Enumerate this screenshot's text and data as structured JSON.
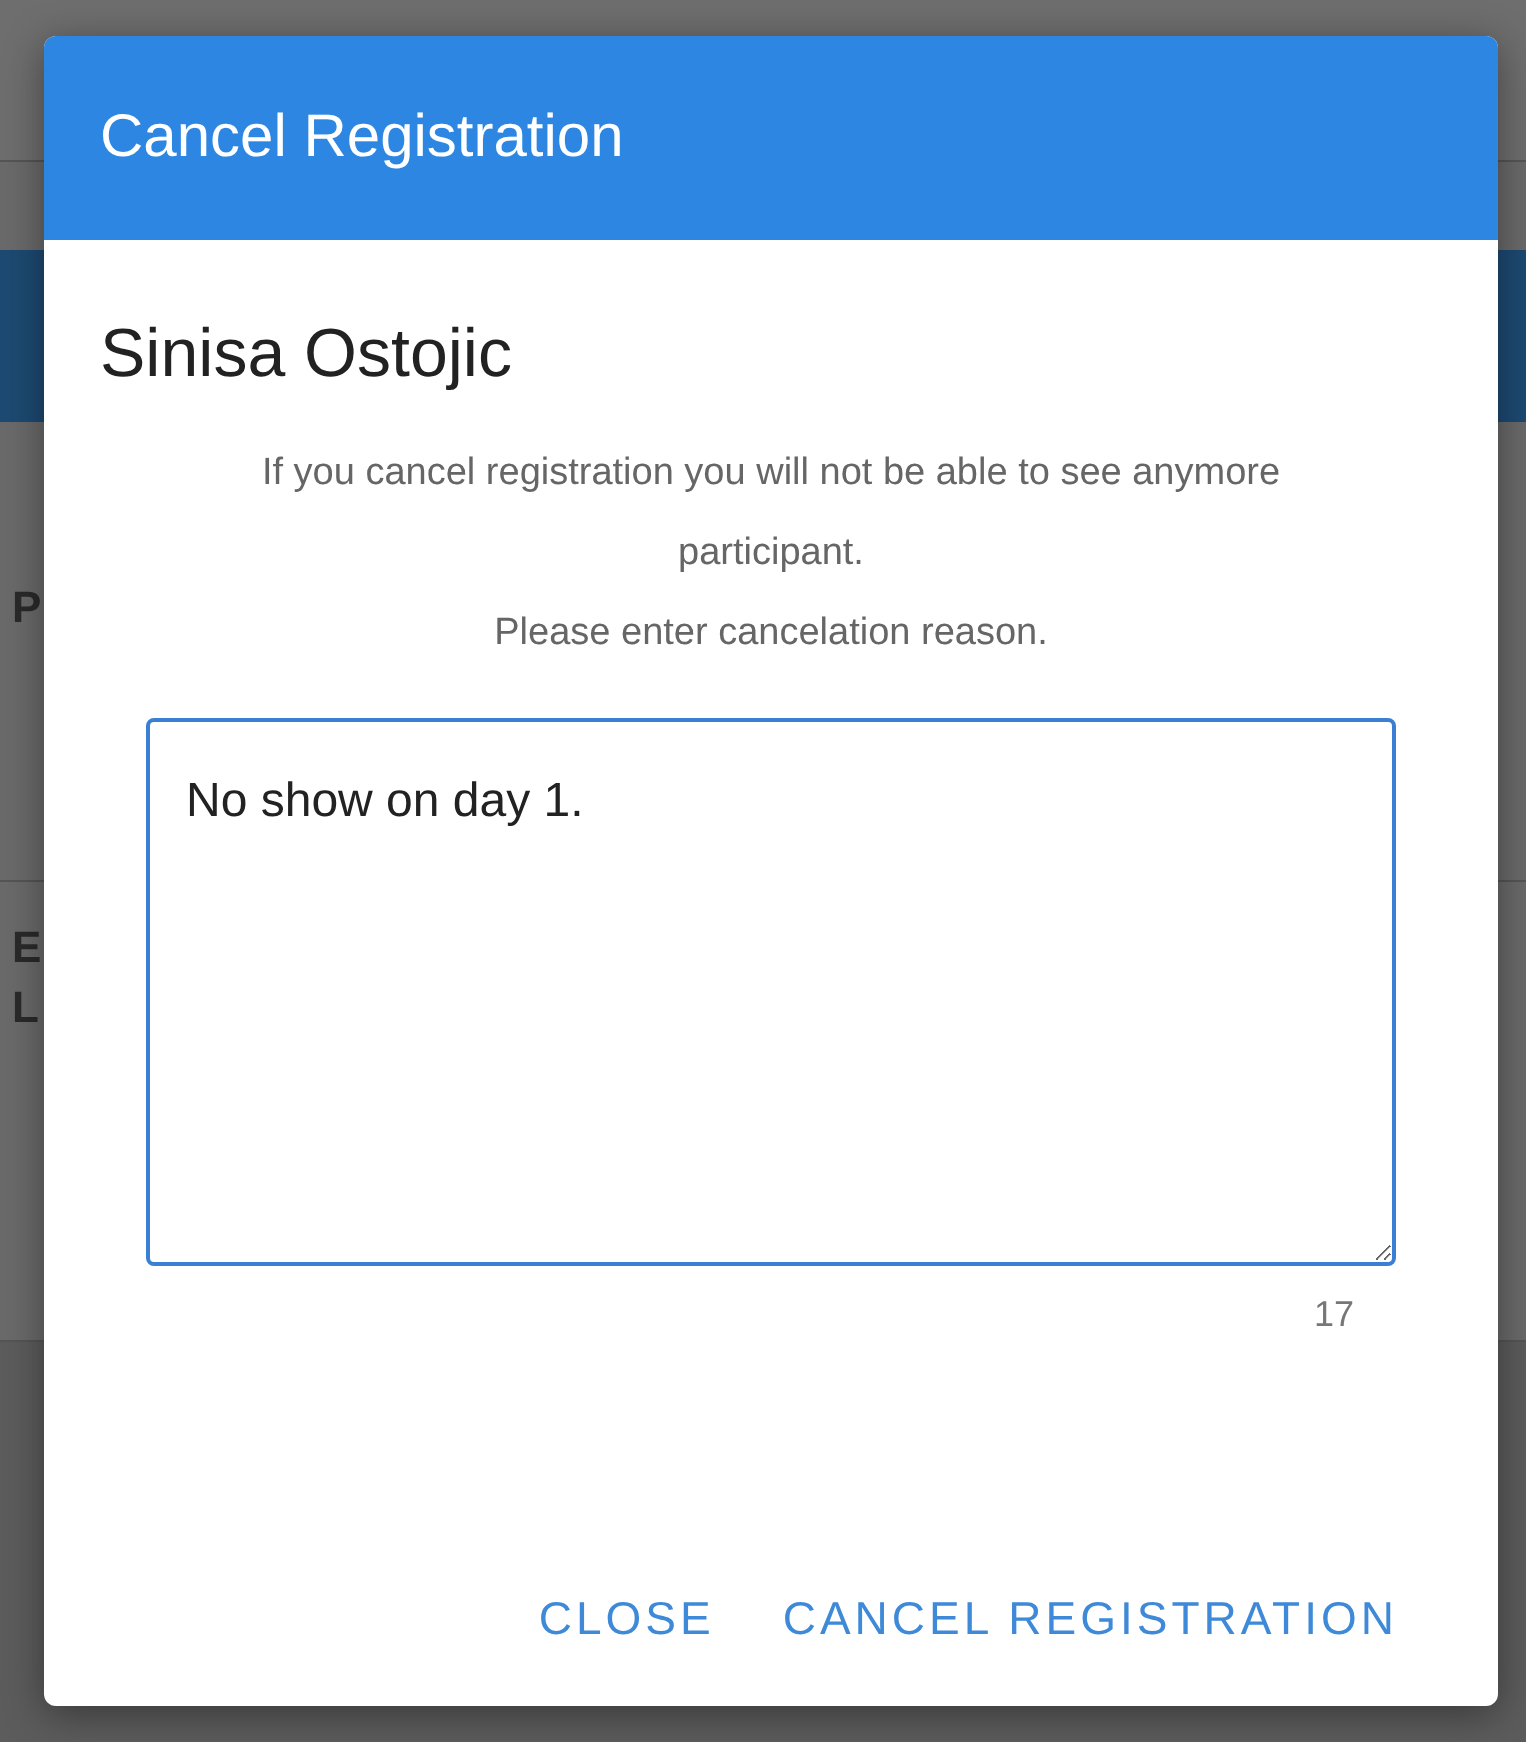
{
  "background": {
    "fragments": [
      "P",
      "E",
      "L"
    ]
  },
  "dialog": {
    "title": "Cancel Registration",
    "participant": "Sinisa Ostojic",
    "message": [
      "If you cancel registration you will not be able to see anymore participant.",
      "Please enter cancelation reason."
    ],
    "reason": {
      "value": "No show on day 1.",
      "counter": "17"
    },
    "buttons": [
      "CLOSE",
      "CANCEL REGISTRATION"
    ]
  }
}
